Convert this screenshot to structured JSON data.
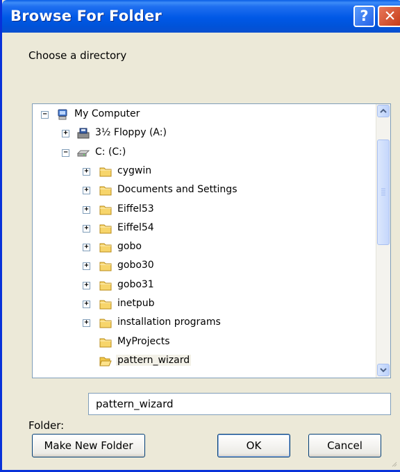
{
  "window": {
    "title": "Browse For Folder",
    "help_glyph": "?",
    "close_glyph": "✕"
  },
  "prompt": "Choose a directory",
  "tree": {
    "items": [
      {
        "label": "My Computer",
        "expander": "−",
        "icon": "computer-icon",
        "depth": 0
      },
      {
        "label": "3½ Floppy (A:)",
        "expander": "+",
        "icon": "floppy-drive-icon",
        "depth": 1
      },
      {
        "label": "C: (C:)",
        "expander": "−",
        "icon": "hard-drive-icon",
        "depth": 1
      },
      {
        "label": "cygwin",
        "expander": "+",
        "icon": "folder-icon",
        "depth": 2
      },
      {
        "label": "Documents and Settings",
        "expander": "+",
        "icon": "folder-icon",
        "depth": 2
      },
      {
        "label": "Eiffel53",
        "expander": "+",
        "icon": "folder-icon",
        "depth": 2
      },
      {
        "label": "Eiffel54",
        "expander": "+",
        "icon": "folder-icon",
        "depth": 2
      },
      {
        "label": "gobo",
        "expander": "+",
        "icon": "folder-icon",
        "depth": 2
      },
      {
        "label": "gobo30",
        "expander": "+",
        "icon": "folder-icon",
        "depth": 2
      },
      {
        "label": "gobo31",
        "expander": "+",
        "icon": "folder-icon",
        "depth": 2
      },
      {
        "label": "inetpub",
        "expander": "+",
        "icon": "folder-icon",
        "depth": 2
      },
      {
        "label": "installation programs",
        "expander": "+",
        "icon": "folder-icon",
        "depth": 2
      },
      {
        "label": "MyProjects",
        "expander": "",
        "icon": "folder-icon",
        "depth": 2
      },
      {
        "label": "pattern_wizard",
        "expander": "",
        "icon": "open-folder-icon",
        "depth": 2,
        "selected": true
      }
    ]
  },
  "folder": {
    "label": "Folder:",
    "value": "pattern_wizard"
  },
  "buttons": {
    "new_folder": "Make New Folder",
    "ok": "OK",
    "cancel": "Cancel"
  },
  "colors": {
    "titlebar": "#0058e6",
    "close": "#c53a17",
    "selection": "#f3f1e8"
  }
}
